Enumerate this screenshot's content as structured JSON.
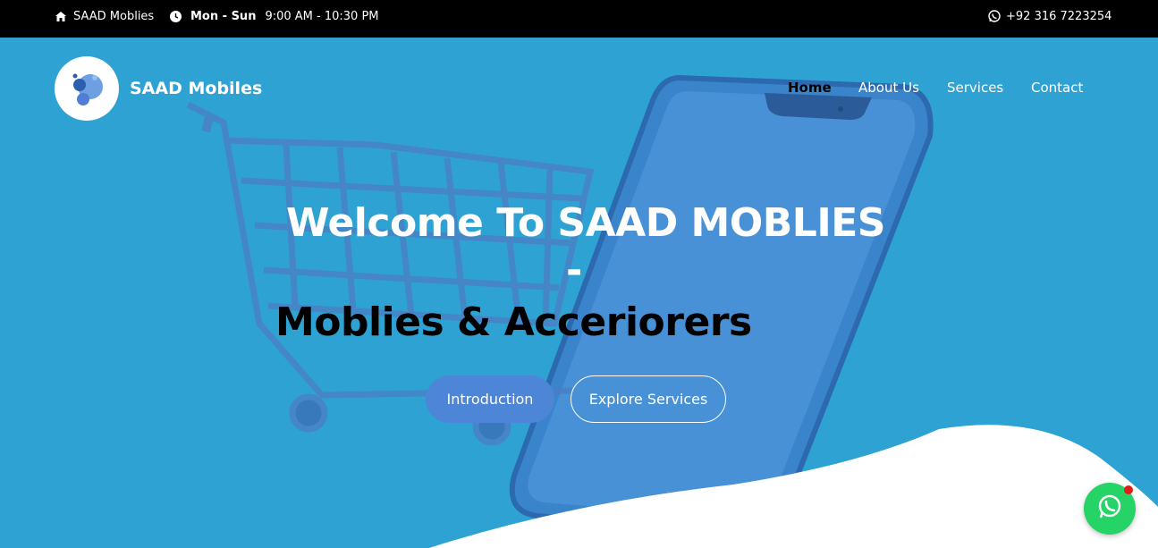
{
  "topbar": {
    "store_name": "SAAD Moblies",
    "days": "Mon - Sun",
    "hours": "9:00 AM - 10:30 PM",
    "phone": "+92 316 7223254",
    "icons": [
      "home-icon",
      "clock-icon",
      "whatsapp-icon"
    ]
  },
  "brand": {
    "name": "SAAD Mobiles",
    "logo_icon": "bubbles-logo-icon"
  },
  "nav": {
    "items": [
      {
        "label": "Home",
        "active": true
      },
      {
        "label": "About Us"
      },
      {
        "label": "Services"
      },
      {
        "label": "Contact"
      }
    ]
  },
  "hero": {
    "title_line1": "Welcome To SAAD MOBLIES",
    "title_dash": "-",
    "title_line2": "Moblies & Acceriorers",
    "primary_button": "Introduction",
    "secondary_button": "Explore Services",
    "background_color": "#2ea3d3"
  },
  "floating": {
    "icon": "whatsapp-icon",
    "color": "#25d366",
    "notification_color": "#e21b1b"
  }
}
